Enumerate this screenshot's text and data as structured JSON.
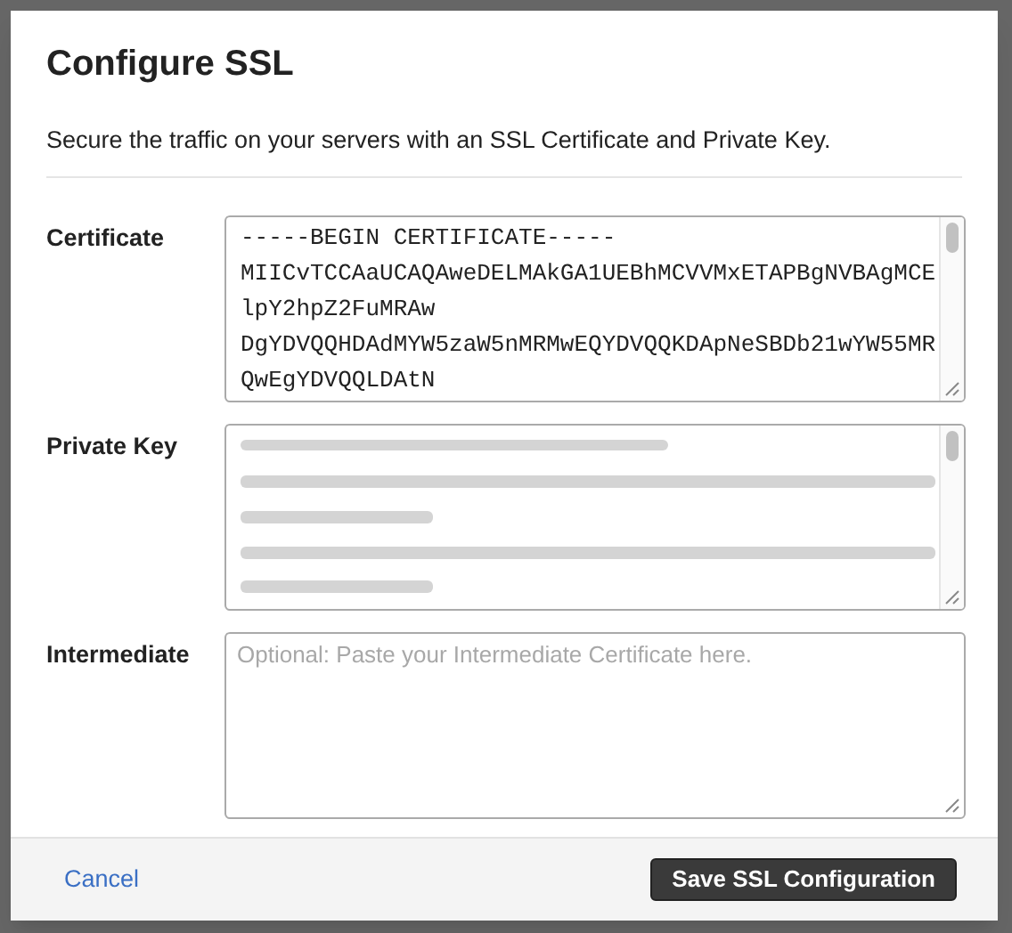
{
  "dialog": {
    "title": "Configure SSL",
    "description": "Secure the traffic on your servers with an SSL Certificate and Private Key."
  },
  "fields": [
    {
      "label": "Certificate",
      "kind": "text",
      "lines": [
        "-----BEGIN CERTIFICATE-----",
        "MIICvTCCAaUCAQAweDELMAkGA1UEBhMCVVMxETAPBgNVBAgMCE",
        "lpY2hpZ2FuMRAw",
        "DgYDVQQHDAdMYW5zaW5nMRMwEQYDVQQKDApNeSBDb21wYW55MR",
        "QwEgYDVQQLDAtN"
      ]
    },
    {
      "label": "Private Key",
      "kind": "blurred"
    },
    {
      "label": "Intermediate",
      "kind": "empty",
      "placeholder": "Optional: Paste your Intermediate Certificate here."
    }
  ],
  "footer": {
    "cancel": "Cancel",
    "save": "Save SSL Configuration"
  }
}
